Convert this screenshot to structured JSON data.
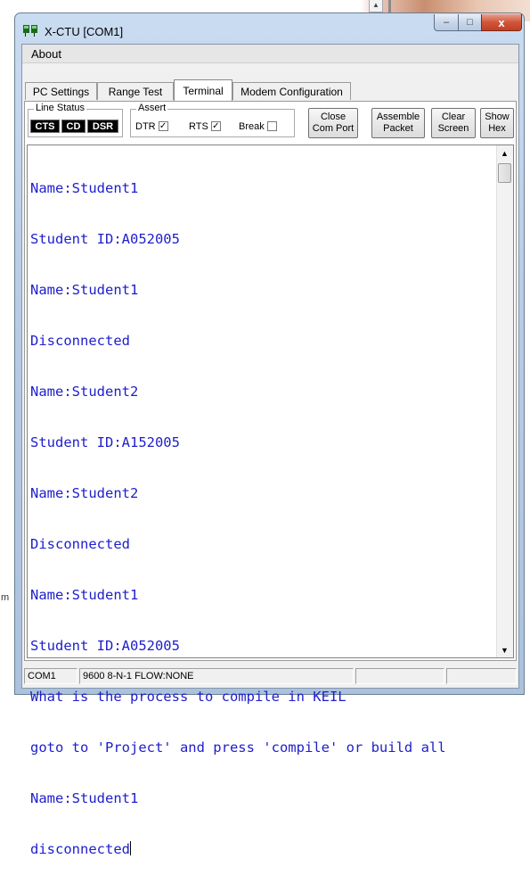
{
  "window": {
    "title": "X-CTU  [COM1]",
    "controls": {
      "minimize": "–",
      "maximize": "□",
      "close": "x"
    }
  },
  "menu": {
    "about": "About"
  },
  "tabs": [
    {
      "label": "PC Settings",
      "active": false
    },
    {
      "label": "Range Test",
      "active": false
    },
    {
      "label": "Terminal",
      "active": true
    },
    {
      "label": "Modem Configuration",
      "active": false
    }
  ],
  "line_status": {
    "label": "Line Status",
    "indicators": [
      "CTS",
      "CD",
      "DSR"
    ]
  },
  "assert": {
    "label": "Assert",
    "items": [
      {
        "label": "DTR",
        "checked": true,
        "mark": "✓"
      },
      {
        "label": "RTS",
        "checked": true,
        "mark": "✓"
      },
      {
        "label": "Break",
        "checked": false,
        "mark": ""
      }
    ]
  },
  "buttons": {
    "close_com": {
      "line1": "Close",
      "line2": "Com Port"
    },
    "assemble": {
      "line1": "Assemble",
      "line2": "Packet"
    },
    "clear": {
      "line1": "Clear",
      "line2": "Screen"
    },
    "show_hex": {
      "line1": "Show",
      "line2": "Hex"
    }
  },
  "terminal": {
    "lines": [
      "Name:Student1",
      "Student ID:A052005",
      "Name:Student1",
      "Disconnected",
      "Name:Student2",
      "Student ID:A152005",
      "Name:Student2",
      "Disconnected",
      "Name:Student1",
      "Student ID:A052005",
      "What is the process to compile in KEIL",
      "goto to 'Project' and press 'compile' or build all",
      "Name:Student1",
      "disconnected"
    ],
    "text_color": "#1e1ecc"
  },
  "status": {
    "port": "COM1",
    "settings": "9600 8-N-1  FLOW:NONE"
  },
  "desktop": {
    "fragment": "m"
  }
}
